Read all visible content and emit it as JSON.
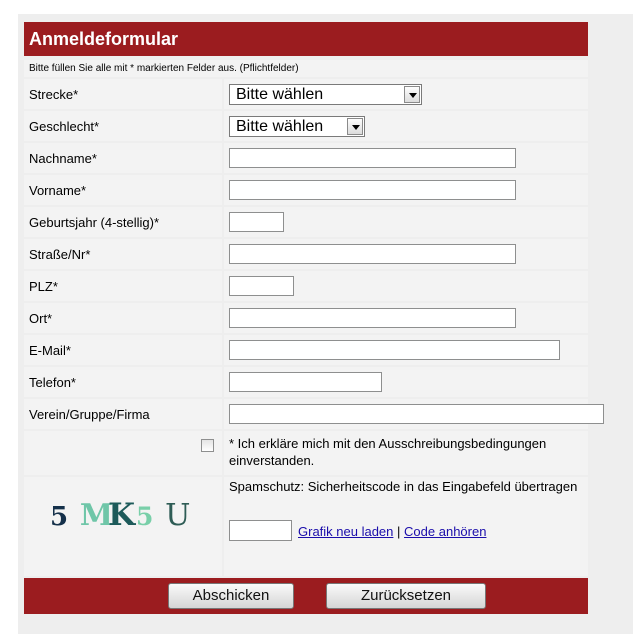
{
  "form": {
    "title": "Anmeldeformular",
    "hint": "Bitte füllen Sie alle mit * markierten Felder aus. (Pflichtfelder)"
  },
  "fields": {
    "strecke": {
      "label": "Strecke*",
      "value": "Bitte wählen"
    },
    "geschlecht": {
      "label": "Geschlecht*",
      "value": "Bitte wählen"
    },
    "nachname": {
      "label": "Nachname*",
      "value": ""
    },
    "vorname": {
      "label": "Vorname*",
      "value": ""
    },
    "geburtsjahr": {
      "label": "Geburtsjahr (4-stellig)*",
      "value": ""
    },
    "strasse": {
      "label": "Straße/Nr*",
      "value": ""
    },
    "plz": {
      "label": "PLZ*",
      "value": ""
    },
    "ort": {
      "label": "Ort*",
      "value": ""
    },
    "email": {
      "label": "E-Mail*",
      "value": ""
    },
    "telefon": {
      "label": "Telefon*",
      "value": ""
    },
    "verein": {
      "label": "Verein/Gruppe/Firma",
      "value": ""
    }
  },
  "agreement": {
    "checked": false,
    "text": "* Ich erkläre mich mit den Ausschreibungsbedingungen einverstanden."
  },
  "captcha": {
    "chars": [
      "5",
      "M",
      "K",
      "5",
      "U"
    ],
    "colors": [
      "#14304a",
      "#6fc6a8",
      "#1d5a5a",
      "#79cfa9",
      "#2e5c55"
    ],
    "instruction": "Spamschutz: Sicherheitscode in das Eingabefeld übertragen",
    "code_value": "",
    "reload_link": "Grafik neu laden",
    "separator": "|",
    "audio_link": "Code anhören"
  },
  "buttons": {
    "submit": "Abschicken",
    "reset": "Zurücksetzen"
  },
  "colors": {
    "accent": "#9b1c1f",
    "row_bg": "#f3f3f3",
    "page_bg": "#eeeeee"
  }
}
